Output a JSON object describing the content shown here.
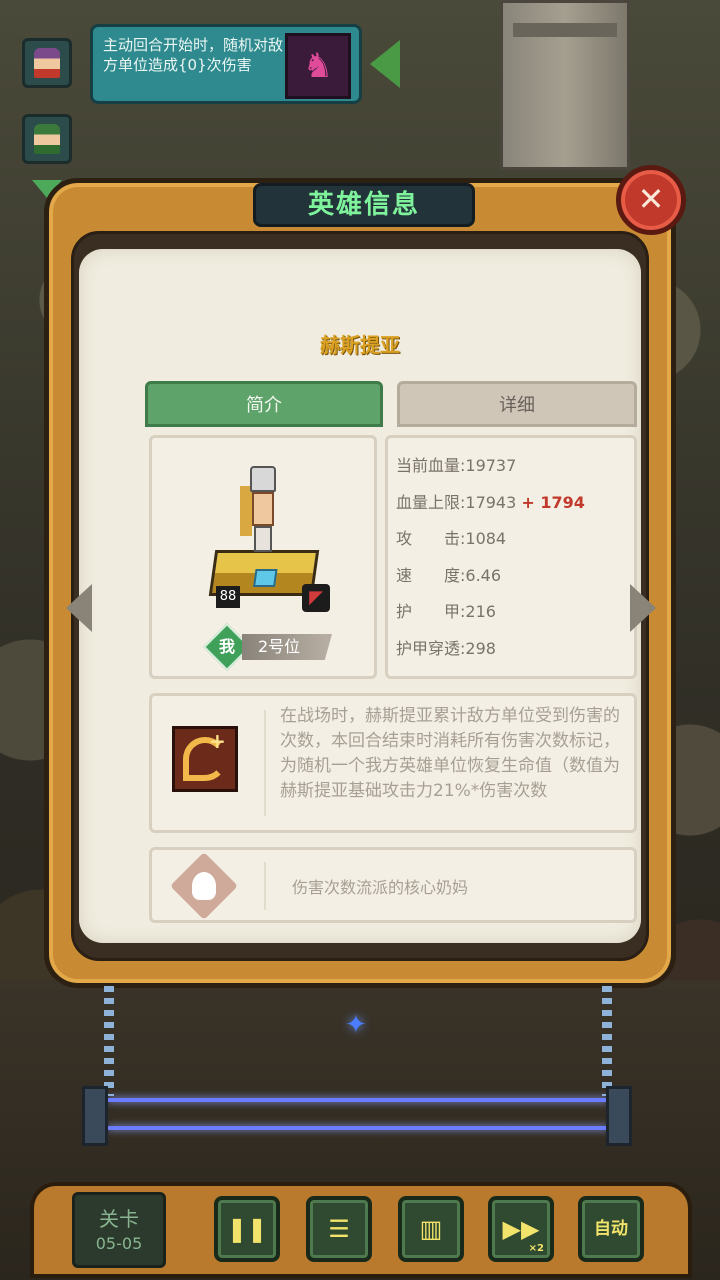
{
  "skill_banner": {
    "text": "主动回合开始时，随机对敌方单位造成{0}次伤害",
    "icon": "rabbit-skill-icon"
  },
  "panel": {
    "title": "英雄信息",
    "close_icon": "close-icon",
    "hero_name": "赫斯提亚",
    "tabs": [
      {
        "label": "简介",
        "active": true
      },
      {
        "label": "详细",
        "active": false
      }
    ]
  },
  "hero": {
    "level": "88",
    "me_label": "我",
    "position": "2号位"
  },
  "stats": {
    "current_hp": "当前血量:19737",
    "max_hp": "血量上限:17943",
    "max_hp_bonus": "+ 1794",
    "attack": "攻　　击:1084",
    "speed": "速　　度:6.46",
    "armor": "护　　甲:216",
    "armor_pen": "护甲穿透:298"
  },
  "skill": {
    "description": "在战场时，赫斯提亚累计敌方单位受到伤害的次数，本回合结束时消耗所有伤害次数标记，为随机一个我方英雄单位恢复生命值（数值为赫斯提亚基础攻击力21%*伤害次数"
  },
  "tip": {
    "text": "伤害次数流派的核心奶妈",
    "icon": "lightbulb-icon"
  },
  "bottom_bar": {
    "stage_label": "关卡",
    "stage_value": "05-05",
    "pause_icon": "pause-icon",
    "order_icon": "formation-icon",
    "stats_icon": "bar-chart-icon",
    "speed_icon": "fast-forward-icon",
    "speed_multiplier": "×2",
    "auto_label": "自动"
  },
  "colors": {
    "title_green": "#7ef39b",
    "hero_name_gold": "#d9a021",
    "bonus_red": "#c0392b",
    "tab_active": "#5da36a"
  }
}
